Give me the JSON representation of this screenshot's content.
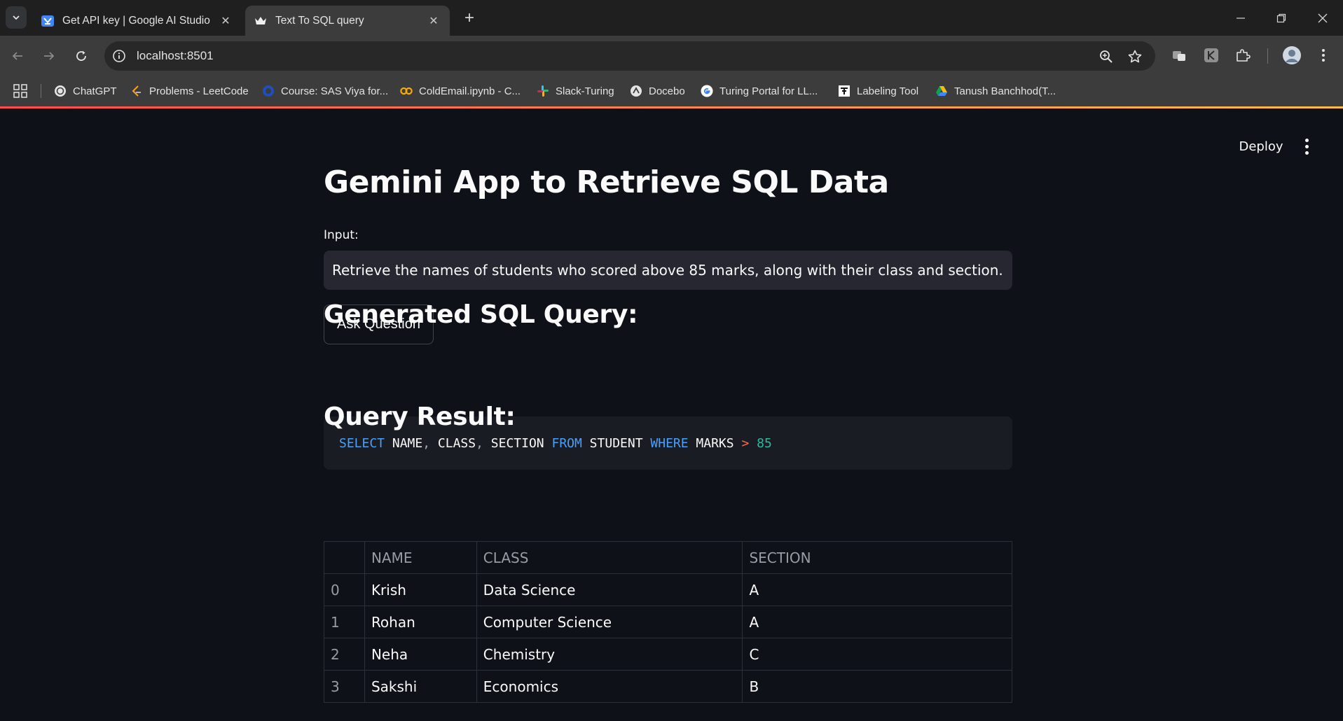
{
  "browser": {
    "tabs": [
      {
        "title": "Get API key | Google AI Studio",
        "icon": "google-ai-studio-icon",
        "active": false
      },
      {
        "title": "Text To SQL query",
        "icon": "streamlit-crown-icon",
        "active": true
      }
    ],
    "url": "localhost:8501",
    "bookmarks": [
      {
        "label": "ChatGPT",
        "icon": "chatgpt-icon"
      },
      {
        "label": "Problems - LeetCode",
        "icon": "leetcode-icon"
      },
      {
        "label": "Course: SAS Viya for...",
        "icon": "course-icon"
      },
      {
        "label": "ColdEmail.ipynb - C...",
        "icon": "colab-icon"
      },
      {
        "label": "Slack-Turing",
        "icon": "slack-icon"
      },
      {
        "label": "Docebo",
        "icon": "docebo-icon"
      },
      {
        "label": "Turing Portal for LL...",
        "icon": "google-icon"
      },
      {
        "label": "Labeling Tool",
        "icon": "labeling-tool-icon"
      },
      {
        "label": "Tanush Banchhod(T...",
        "icon": "google-drive-icon"
      }
    ]
  },
  "app": {
    "deploy_label": "Deploy",
    "title": "Gemini App to Retrieve SQL Data",
    "input_label": "Input:",
    "input_value": "Retrieve the names of students who scored above 85 marks, along with their class and section.",
    "ask_button_label": "Ask Question",
    "sql_heading": "Generated SQL Query:",
    "sql_tokens": [
      {
        "t": "SELECT",
        "c": "kw"
      },
      {
        "t": " NAME",
        "c": ""
      },
      {
        "t": ",",
        "c": "pn"
      },
      {
        "t": " CLASS",
        "c": ""
      },
      {
        "t": ",",
        "c": "pn"
      },
      {
        "t": " SECTION ",
        "c": ""
      },
      {
        "t": "FROM",
        "c": "kw"
      },
      {
        "t": " STUDENT ",
        "c": ""
      },
      {
        "t": "WHERE",
        "c": "kw"
      },
      {
        "t": " MARKS ",
        "c": ""
      },
      {
        "t": ">",
        "c": "op"
      },
      {
        "t": " 85",
        "c": "nm"
      }
    ],
    "result_heading": "Query Result:",
    "table": {
      "columns": [
        "",
        "NAME",
        "CLASS",
        "SECTION"
      ],
      "rows": [
        [
          "0",
          "Krish",
          "Data Science",
          "A"
        ],
        [
          "1",
          "Rohan",
          "Computer Science",
          "A"
        ],
        [
          "2",
          "Neha",
          "Chemistry",
          "C"
        ],
        [
          "3",
          "Sakshi",
          "Economics",
          "B"
        ]
      ]
    }
  },
  "colors": {
    "app_bg": "#0e1117",
    "input_bg": "#262730",
    "sql_keyword": "#4b9ff6",
    "sql_operator": "#ff6b4a",
    "sql_number": "#2fb89c",
    "accent_gradient_start": "#ff4b4b",
    "accent_gradient_end": "#ffbd45"
  }
}
